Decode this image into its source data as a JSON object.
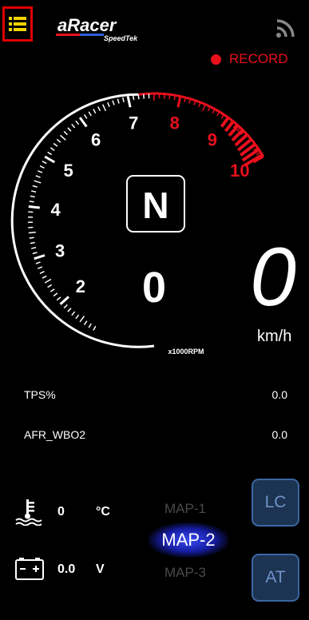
{
  "header": {
    "menu_icon": "list-icon",
    "logo_text": "aRacer",
    "logo_sub": "SpeedTek",
    "wifi_icon": "wifi-icon",
    "record_label": "RECORD",
    "record_color": "#e8101d"
  },
  "tach": {
    "marks": [
      "2",
      "3",
      "4",
      "5",
      "6",
      "7",
      "8",
      "9",
      "10"
    ],
    "unit_label": "x1000RPM",
    "gear": "N",
    "gear_selected": "0",
    "redline_color": "#e8101d"
  },
  "speed": {
    "value": "0",
    "unit": "km/h"
  },
  "readouts": [
    {
      "label": "TPS%",
      "value": "0.0"
    },
    {
      "label": "AFR_WBO2",
      "value": "0.0"
    }
  ],
  "bottom": {
    "coolant_icon": "coolant-temp-icon",
    "coolant_value": "0",
    "coolant_unit": "°C",
    "battery_icon": "battery-icon",
    "battery_value": "0.0",
    "battery_unit": "V",
    "maps": [
      "MAP-1",
      "MAP-2",
      "MAP-3"
    ],
    "selected_map": "MAP-2",
    "lc_label": "LC",
    "at_label": "AT"
  }
}
